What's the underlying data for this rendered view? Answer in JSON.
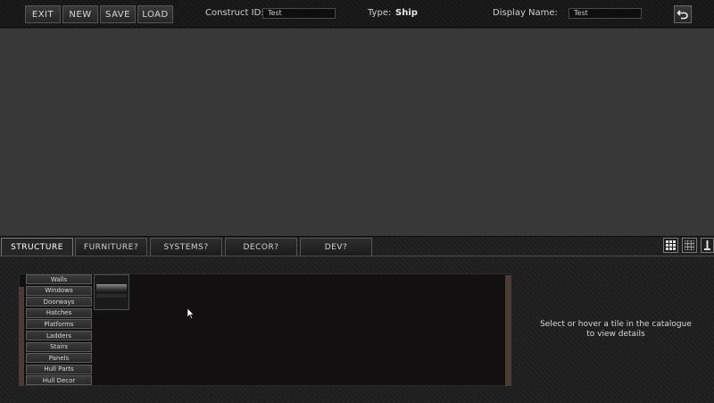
{
  "toolbar": {
    "exit_label": "EXIT",
    "new_label": "NEW",
    "save_label": "SAVE",
    "load_label": "LOAD",
    "construct_id_label": "Construct ID:",
    "construct_id_value": "Test",
    "type_label": "Type:",
    "type_value": "Ship",
    "display_name_label": "Display Name:",
    "display_name_value": "Test",
    "undo_icon": "undo-icon"
  },
  "tabs": [
    {
      "label": "STRUCTURE",
      "active": true
    },
    {
      "label": "FURNITURE?",
      "active": false
    },
    {
      "label": "SYSTEMS?",
      "active": false
    },
    {
      "label": "DECOR?",
      "active": false
    },
    {
      "label": "DEV?",
      "active": false
    }
  ],
  "view_modes": [
    "large-grid-icon",
    "small-grid-icon",
    "list-icon"
  ],
  "categories": [
    "Walls",
    "Windows",
    "Doorways",
    "Hatches",
    "Platforms",
    "Ladders",
    "Stairs",
    "Panels",
    "Hull Parts",
    "Hull Decor"
  ],
  "details": {
    "placeholder": "Select or hover a tile in the catalogue to view details"
  },
  "colors": {
    "viewport_bg": "#383838",
    "catalogue_bg": "#121010",
    "scrollbar": "#4a3b35"
  }
}
